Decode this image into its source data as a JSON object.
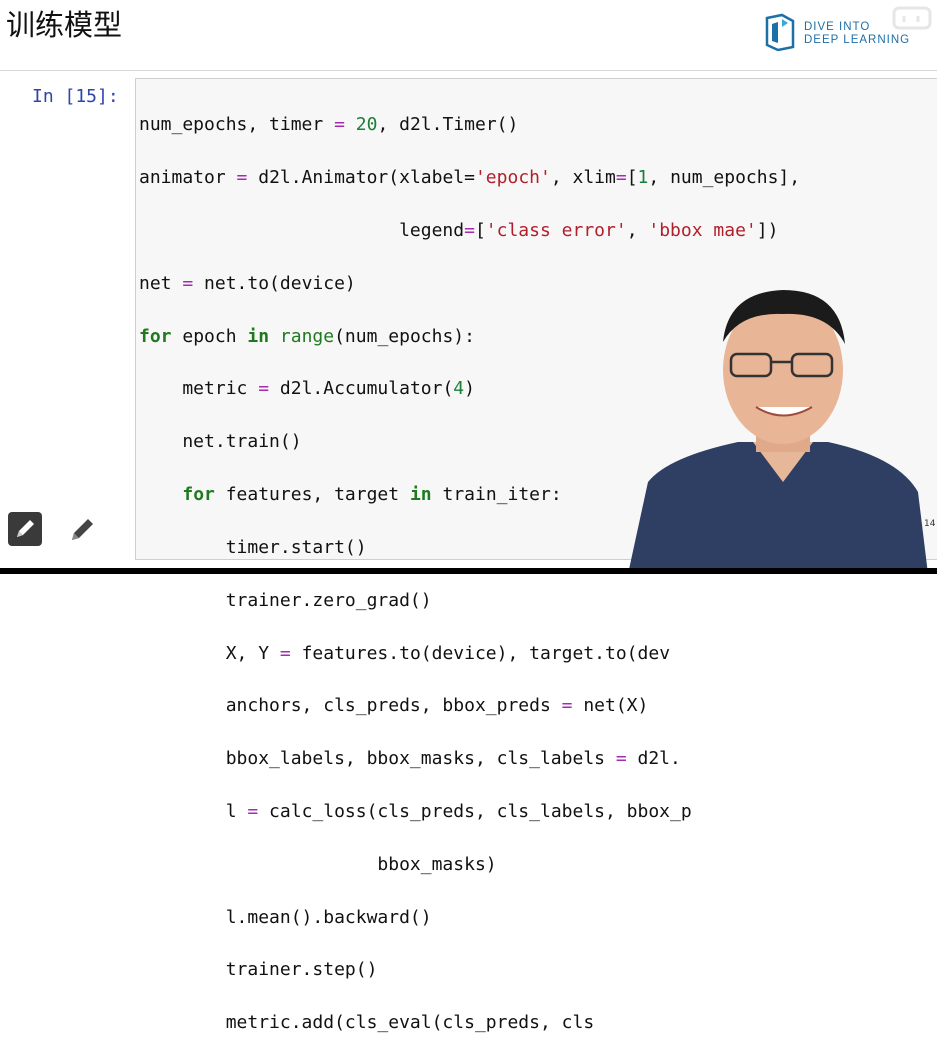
{
  "page": {
    "title": "训练模型"
  },
  "logo": {
    "line1": "DIVE INTO",
    "line2": "DEEP LEARNING"
  },
  "cell": {
    "prompt": "In [15]:",
    "lines": [
      "num_epochs, timer = 20, d2l.Timer()",
      "animator = d2l.Animator(xlabel='epoch', xlim=[1, num_epochs],",
      "                        legend=['class error', 'bbox mae'])",
      "net = net.to(device)",
      "for epoch in range(num_epochs):",
      "    metric = d2l.Accumulator(4)",
      "    net.train()",
      "    for features, target in train_iter:",
      "        timer.start()",
      "        trainer.zero_grad()",
      "        X, Y = features.to(device), target.to(dev",
      "        anchors, cls_preds, bbox_preds = net(X)",
      "        bbox_labels, bbox_masks, cls_labels = d2l.",
      "        l = calc_loss(cls_preds, cls_labels, bbox_p",
      "                      bbox_masks)",
      "        l.mean().backward()",
      "        trainer.step()",
      "        metric.add(cls_eval(cls_preds, cls"
    ]
  },
  "page_number": "14",
  "icons": {
    "edit_dark": "pencil-icon",
    "edit_light": "pencil-icon",
    "logo": "d2l-logo-icon",
    "watermark": "bilibili-icon"
  },
  "colors": {
    "keyword": "#1f7a1f",
    "number": "#1a7f37",
    "string": "#b21f2a",
    "operator": "#a52ab0",
    "prompt": "#3045a8"
  }
}
